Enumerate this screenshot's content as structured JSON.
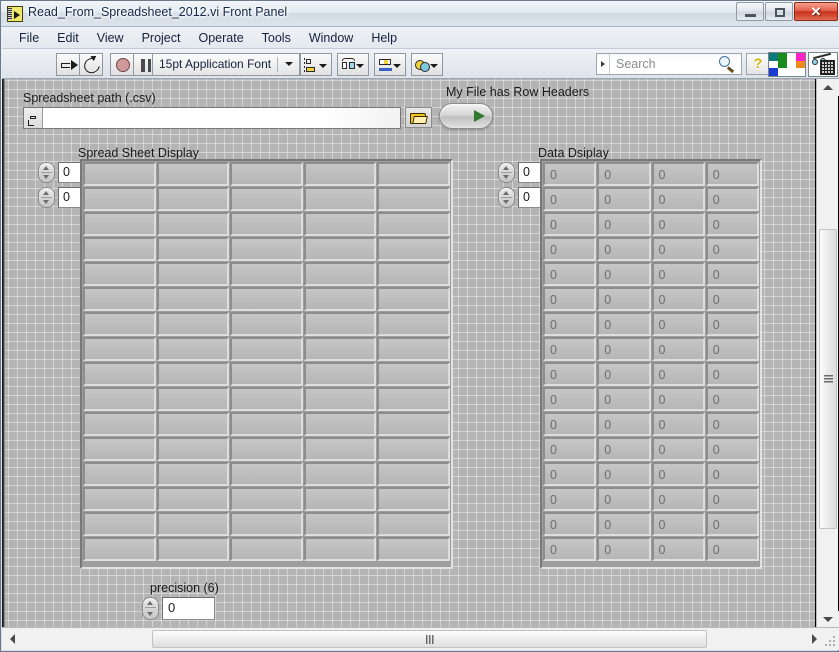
{
  "window": {
    "title": "Read_From_Spreadsheet_2012.vi Front Panel",
    "icon_name": "labview-vi-icon",
    "buttons": {
      "minimize": "minimize",
      "restore": "restore",
      "close": "✕"
    }
  },
  "menubar": {
    "items": [
      {
        "label": "File"
      },
      {
        "label": "Edit"
      },
      {
        "label": "View"
      },
      {
        "label": "Project"
      },
      {
        "label": "Operate"
      },
      {
        "label": "Tools"
      },
      {
        "label": "Window"
      },
      {
        "label": "Help"
      }
    ]
  },
  "toolbar": {
    "run_button": "run-arrow-icon",
    "run_continuously_button": "run-continuously-icon",
    "abort_button": "abort-execution-icon",
    "pause_button": "pause-icon",
    "font_selector": "15pt Application Font",
    "align_objects": "align-objects-icon",
    "distribute_objects": "distribute-objects-icon",
    "resize_objects": "resize-objects-icon",
    "reorder_objects": "reorder-objects-icon",
    "palette_colors": [
      "#0f7a7a",
      "#1a8a1a",
      "#ffffff",
      "#ff22c8",
      "#ffffff",
      "#1a8a1a",
      "#ffffff",
      "#f08a1a",
      "#1a3ad0",
      "#ffffff",
      "#ffffff",
      "#ffffff"
    ],
    "project_icon": "vi-search-grid-icon"
  },
  "search": {
    "placeholder": "Search",
    "dropdown_icon": "search-dropdown-arrow-icon",
    "magnifier_icon": "search-icon",
    "help_label": "?"
  },
  "panel": {
    "path_control": {
      "label": "Spreadsheet path (.csv)",
      "value": "",
      "icon_name": "path-symbol-icon",
      "browse_button_icon": "folder-browse-icon"
    },
    "row_headers_switch": {
      "label": "My File has Row Headers",
      "state": "off"
    },
    "spreadsheet_display": {
      "label": "Spread Sheet Display",
      "index_row": "0",
      "index_col": "0",
      "columns": 5,
      "rows": 16,
      "cells": [
        [
          "",
          "",
          "",
          "",
          ""
        ],
        [
          "",
          "",
          "",
          "",
          ""
        ],
        [
          "",
          "",
          "",
          "",
          ""
        ],
        [
          "",
          "",
          "",
          "",
          ""
        ],
        [
          "",
          "",
          "",
          "",
          ""
        ],
        [
          "",
          "",
          "",
          "",
          ""
        ],
        [
          "",
          "",
          "",
          "",
          ""
        ],
        [
          "",
          "",
          "",
          "",
          ""
        ],
        [
          "",
          "",
          "",
          "",
          ""
        ],
        [
          "",
          "",
          "",
          "",
          ""
        ],
        [
          "",
          "",
          "",
          "",
          ""
        ],
        [
          "",
          "",
          "",
          "",
          ""
        ],
        [
          "",
          "",
          "",
          "",
          ""
        ],
        [
          "",
          "",
          "",
          "",
          ""
        ],
        [
          "",
          "",
          "",
          "",
          ""
        ],
        [
          "",
          "",
          "",
          "",
          ""
        ]
      ]
    },
    "data_display": {
      "label": "Data Dsiplay",
      "index_row": "0",
      "index_col": "0",
      "columns": 4,
      "rows": 16,
      "cells": [
        [
          "0",
          "0",
          "0",
          "0"
        ],
        [
          "0",
          "0",
          "0",
          "0"
        ],
        [
          "0",
          "0",
          "0",
          "0"
        ],
        [
          "0",
          "0",
          "0",
          "0"
        ],
        [
          "0",
          "0",
          "0",
          "0"
        ],
        [
          "0",
          "0",
          "0",
          "0"
        ],
        [
          "0",
          "0",
          "0",
          "0"
        ],
        [
          "0",
          "0",
          "0",
          "0"
        ],
        [
          "0",
          "0",
          "0",
          "0"
        ],
        [
          "0",
          "0",
          "0",
          "0"
        ],
        [
          "0",
          "0",
          "0",
          "0"
        ],
        [
          "0",
          "0",
          "0",
          "0"
        ],
        [
          "0",
          "0",
          "0",
          "0"
        ],
        [
          "0",
          "0",
          "0",
          "0"
        ],
        [
          "0",
          "0",
          "0",
          "0"
        ],
        [
          "0",
          "0",
          "0",
          "0"
        ]
      ]
    },
    "precision_control": {
      "label": "precision (6)",
      "value": "0"
    }
  },
  "scrollbars": {
    "vertical_up_icon": "scroll-up-arrow-icon",
    "vertical_down_icon": "scroll-down-arrow-icon",
    "horizontal_left_icon": "scroll-left-arrow-icon",
    "horizontal_right_icon": "scroll-right-arrow-icon"
  }
}
